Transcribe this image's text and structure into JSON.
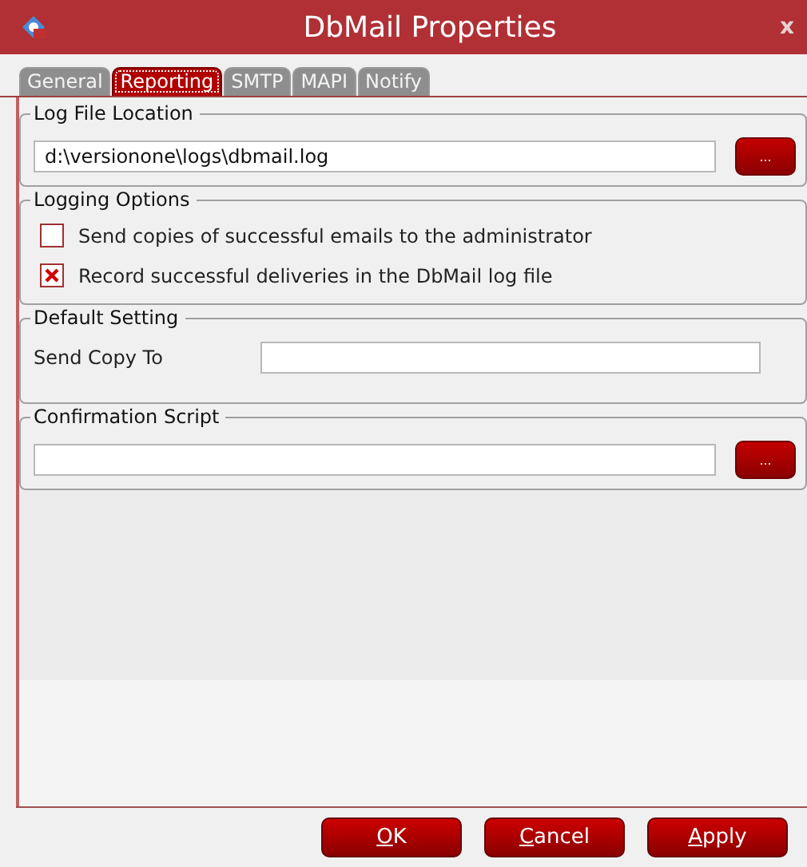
{
  "window": {
    "title": "DbMail Properties",
    "close": "x"
  },
  "tabs": [
    {
      "label": "General",
      "selected": false
    },
    {
      "label": "Reporting",
      "selected": true
    },
    {
      "label": "SMTP",
      "selected": false
    },
    {
      "label": "MAPI",
      "selected": false
    },
    {
      "label": "Notify",
      "selected": false
    }
  ],
  "groups": [
    {
      "kind": "file",
      "title": "Log File Location",
      "value": "d:\\versionone\\logs\\dbmail.log",
      "browse": "..."
    },
    {
      "kind": "checks",
      "title": "Logging Options",
      "options": [
        {
          "label": "Send copies of successful emails to the administrator",
          "checked": false
        },
        {
          "label": "Record successful deliveries in the DbMail log file",
          "checked": true
        }
      ]
    },
    {
      "kind": "labeled",
      "title": "Default Setting",
      "label": "Send Copy To"
    },
    {
      "kind": "file",
      "title": "Confirmation Script",
      "browse": "..."
    }
  ],
  "buttons": [
    {
      "key": "O",
      "rest": "K"
    },
    {
      "key": "C",
      "rest": "ancel"
    },
    {
      "key": "A",
      "rest": "pply"
    }
  ]
}
